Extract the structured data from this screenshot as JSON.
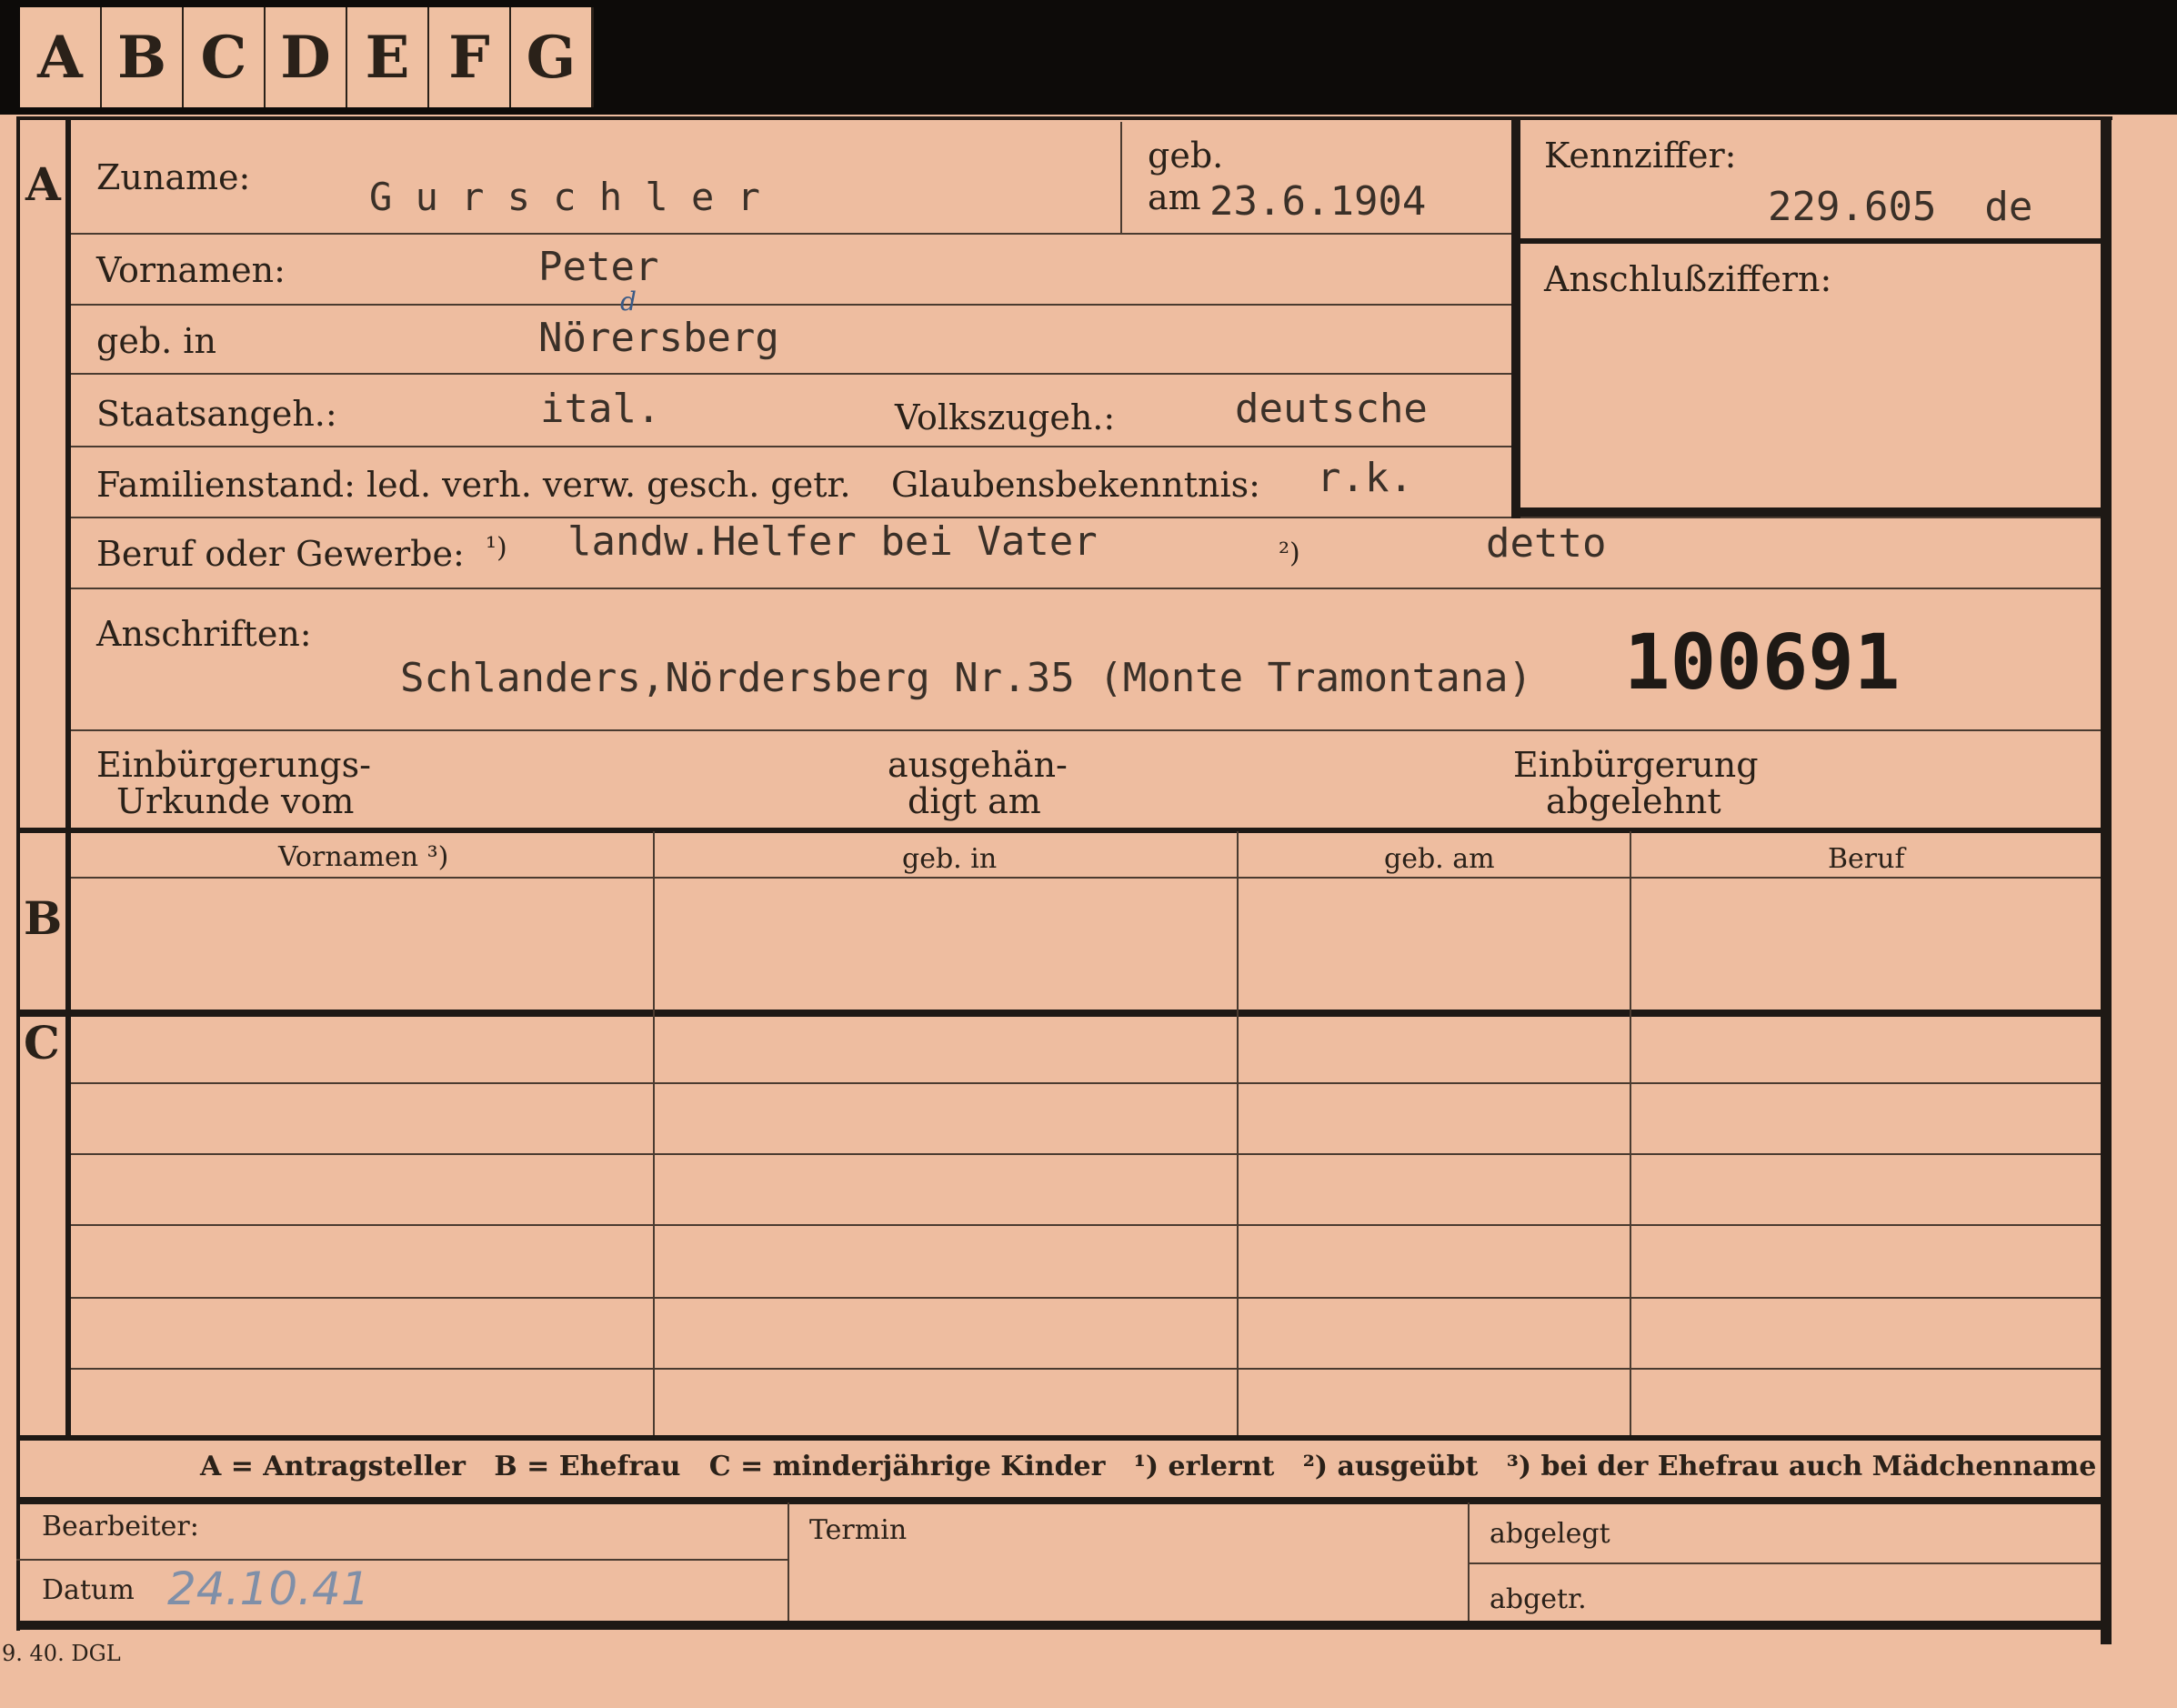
{
  "tabs": [
    "A",
    "B",
    "C",
    "D",
    "E",
    "F",
    "G"
  ],
  "sections": {
    "a": "A",
    "b": "B",
    "c": "C"
  },
  "fields": {
    "zuname_label": "Zuname:",
    "zuname_value": "G u r s c h l e r",
    "geb_label": "geb.",
    "geb_am_label": "am",
    "geb_am_value": "23.6.1904",
    "kennziffer_label": "Kennziffer:",
    "kennziffer_value": "229.605  de",
    "anschluss_label": "Anschlußziffern:",
    "vornamen_label": "Vornamen:",
    "vornamen_value": "Peter",
    "gebin_label": "geb. in",
    "gebin_value": "Nörersberg",
    "gebin_correction": "d",
    "staat_label": "Staatsangeh.:",
    "staat_value": "ital.",
    "volks_label": "Volkszugeh.:",
    "volks_value": "deutsche",
    "familien_label": "Familienstand: led. verh. verw. gesch. getr.",
    "glauben_label": "Glaubensbekenntnis:",
    "glauben_value": "r.k.",
    "beruf_label": "Beruf oder Gewerbe:",
    "beruf_mark1": "¹)",
    "beruf_value1": "landw.Helfer bei Vater",
    "beruf_mark2": "²)",
    "beruf_value2": "detto",
    "anschriften_label": "Anschriften:",
    "anschriften_value": "Schlanders,Nördersberg Nr.35 (Monte Tramontana)",
    "stamp_number": "100691",
    "einb_label_1": "Einbürgerungs-",
    "einb_label_2": "Urkunde vom",
    "ausgeh_label_1": "ausgehän-",
    "ausgeh_label_2": "digt am",
    "abgelehnt_label_1": "Einbürgerung",
    "abgelehnt_label_2": "abgelehnt"
  },
  "table_headers": [
    "Vornamen ³)",
    "geb. in",
    "geb. am",
    "Beruf"
  ],
  "legend": "A = Antragsteller   B = Ehefrau   C = minderjährige Kinder   ¹) erlernt   ²) ausgeübt   ³) bei der Ehefrau auch Mädchenname",
  "footer": {
    "bearbeiter_label": "Bearbeiter:",
    "datum_label": "Datum",
    "datum_value": "24.10.41",
    "termin_label": "Termin",
    "abgelegt_label": "abgelegt",
    "abgetr_label": "abgetr.",
    "print_code": "9. 40. DGL"
  },
  "colors": {
    "card": "#eebda0",
    "ink": "#2a2119",
    "pencil": "#7f8fa8"
  }
}
